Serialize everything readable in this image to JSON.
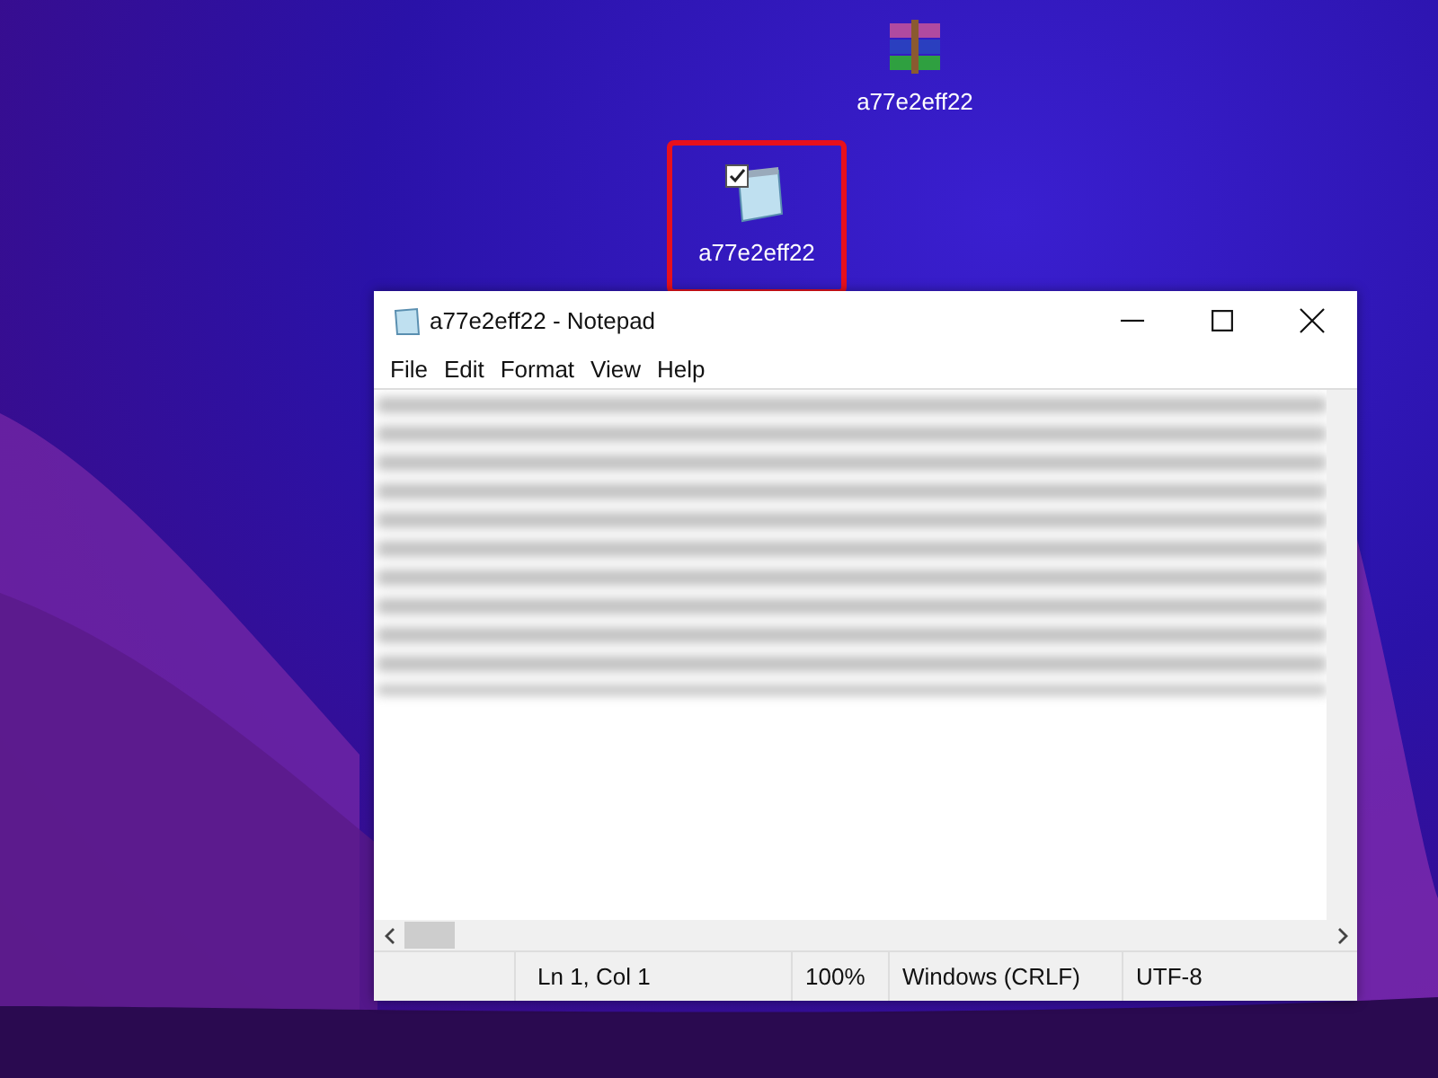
{
  "desktop_icons": [
    {
      "kind": "archive",
      "label": "a77e2eff22",
      "highlighted": false
    },
    {
      "kind": "notepad",
      "label": "a77e2eff22",
      "highlighted": true
    }
  ],
  "window": {
    "title": "a77e2eff22 - Notepad"
  },
  "menu": [
    "File",
    "Edit",
    "Format",
    "View",
    "Help"
  ],
  "status_bar": [
    "Ln 1, Col 1",
    "100%",
    "Windows (CRLF)",
    "UTF-8"
  ]
}
